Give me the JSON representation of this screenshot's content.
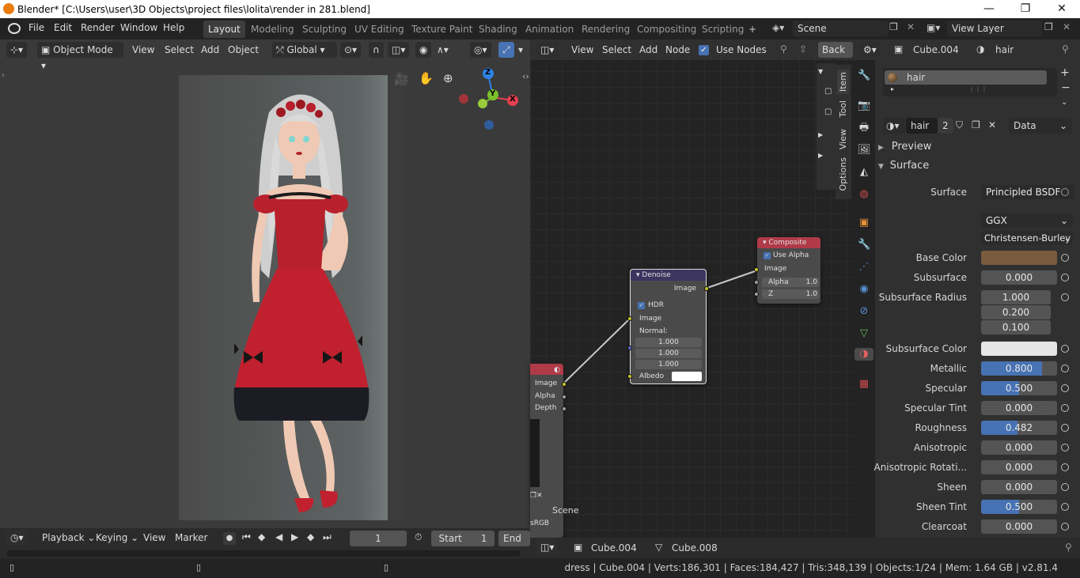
{
  "window": {
    "title": "Blender* [C:\\Users\\user\\3D Objects\\project files\\lolita\\render in 281.blend]",
    "minimize": "—",
    "maximize": "❐",
    "close": "✕"
  },
  "menu": [
    "File",
    "Edit",
    "Render",
    "Window",
    "Help"
  ],
  "workspaces": [
    "Layout",
    "Modeling",
    "Sculpting",
    "UV Editing",
    "Texture Paint",
    "Shading",
    "Animation",
    "Rendering",
    "Compositing",
    "Scripting"
  ],
  "active_workspace": "Layout",
  "scene": {
    "name": "Scene",
    "view_layer": "View Layer"
  },
  "viewport": {
    "mode": "Object Mode",
    "menus": [
      "View",
      "Select",
      "Add",
      "Object"
    ],
    "transform_orientation": "Global",
    "gizmo": {
      "z": "Z",
      "y": "Y",
      "x": "X"
    }
  },
  "node_editor": {
    "menus": [
      "View",
      "Select",
      "Add",
      "Node"
    ],
    "use_nodes_label": "Use Nodes",
    "backdrop_label": "Back",
    "side_tabs": [
      "Item",
      "Tool",
      "View",
      "Options"
    ],
    "denoise": {
      "title": "Denoise",
      "out_image": "Image",
      "hdr": "HDR",
      "in_image": "Image",
      "normal": "Normal:",
      "normal_values": [
        "1.000",
        "1.000",
        "1.000"
      ],
      "albedo": "Albedo"
    },
    "composite": {
      "title": "Composite",
      "use_alpha": "Use Alpha",
      "image": "Image",
      "alpha": "Alpha",
      "alpha_val": "1.0",
      "z": "Z",
      "z_val": "1.0"
    },
    "render_layers": {
      "outputs": [
        "Image",
        "Alpha",
        "Depth"
      ],
      "scene": "Scene",
      "colorspace": "sRGB"
    },
    "footer": {
      "object": "Cube.004",
      "mesh": "Cube.008"
    }
  },
  "properties": {
    "header_object": "Cube.004",
    "header_material": "hair",
    "material_slot": "hair",
    "material_name": "hair",
    "user_count": "2",
    "link": "Data",
    "panels": {
      "preview": "Preview",
      "surface": "Surface"
    },
    "surface_label": "Surface",
    "surface_shader": "Principled BSDF",
    "distribution": "GGX",
    "subsurface_method": "Christensen-Burley",
    "base_color": "#7a5b3e",
    "subsurface_color": "#e6e6e6",
    "rows": [
      {
        "label": "Base Color",
        "value": "",
        "kind": "color"
      },
      {
        "label": "Subsurface",
        "value": "0.000",
        "fill": 0
      },
      {
        "label": "Subsurface Radius",
        "values": [
          "1.000",
          "0.200",
          "0.100"
        ]
      },
      {
        "label": "Subsurface Color",
        "value": "",
        "kind": "color2"
      },
      {
        "label": "Metallic",
        "value": "0.800",
        "fill": 0.8
      },
      {
        "label": "Specular",
        "value": "0.500",
        "fill": 0.5
      },
      {
        "label": "Specular Tint",
        "value": "0.000",
        "fill": 0
      },
      {
        "label": "Roughness",
        "value": "0.482",
        "fill": 0.482
      },
      {
        "label": "Anisotropic",
        "value": "0.000",
        "fill": 0
      },
      {
        "label": "Anisotropic Rotati...",
        "value": "0.000",
        "fill": 0
      },
      {
        "label": "Sheen",
        "value": "0.000",
        "fill": 0
      },
      {
        "label": "Sheen Tint",
        "value": "0.500",
        "fill": 0.5
      },
      {
        "label": "Clearcoat",
        "value": "0.000",
        "fill": 0
      }
    ]
  },
  "timeline": {
    "menus": [
      "Playback",
      "Keying",
      "View",
      "Marker"
    ],
    "current_frame": "1",
    "start_label": "Start",
    "start_value": "1",
    "end_label": "End"
  },
  "status": "dress | Cube.004 | Verts:186,301 | Faces:184,427 | Tris:348,139 | Objects:1/24 | Mem: 1.64 GB | v2.81.4",
  "colors": {
    "accent": "#4772b3",
    "composite_header": "#b03a48",
    "denoise_header": "#3b3560"
  }
}
